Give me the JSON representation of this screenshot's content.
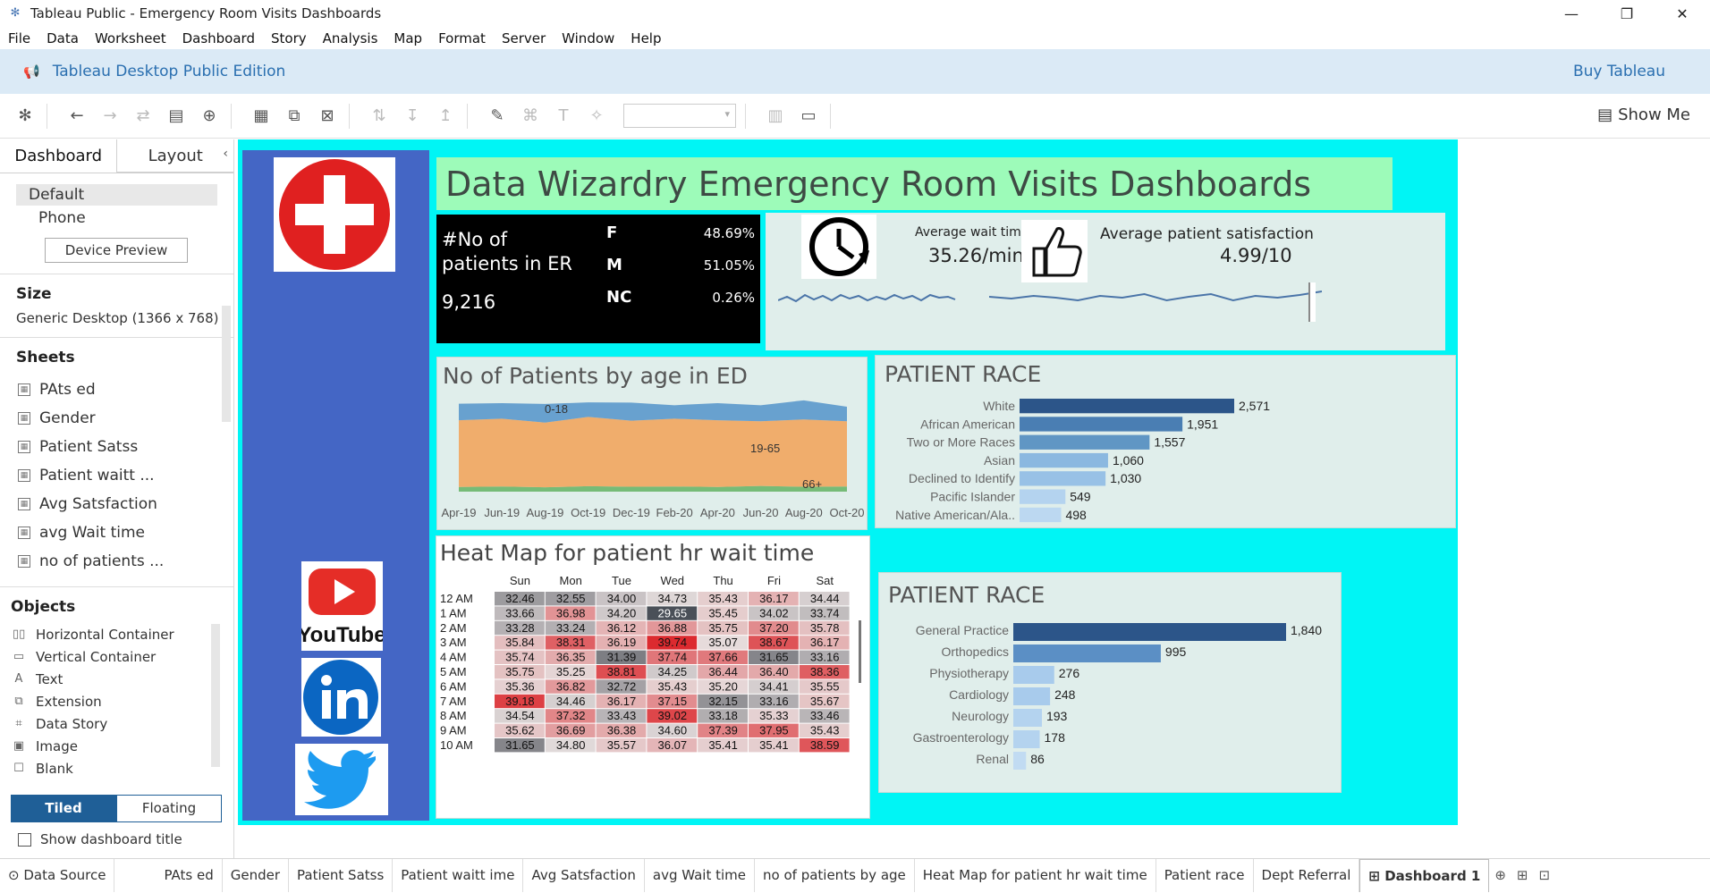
{
  "window": {
    "title": "Tableau Public - Emergency Room Visits Dashboards",
    "minimize": "—",
    "maximize": "❐",
    "close": "✕"
  },
  "menu": [
    "File",
    "Data",
    "Worksheet",
    "Dashboard",
    "Story",
    "Analysis",
    "Map",
    "Format",
    "Server",
    "Window",
    "Help"
  ],
  "banner": {
    "edition": "Tableau Desktop Public Edition",
    "buy": "Buy Tableau"
  },
  "toolbar": {
    "show_me": "Show Me"
  },
  "left_pane": {
    "tab_dashboard": "Dashboard",
    "tab_layout": "Layout",
    "collapse": "‹",
    "device_default": "Default",
    "device_phone": "Phone",
    "device_preview": "Device Preview",
    "size_heading": "Size",
    "size_value": "Generic Desktop (1366 x 768) ▾",
    "sheets_heading": "Sheets",
    "sheets": [
      "PAts ed",
      "Gender",
      "Patient Satss",
      "Patient waitt ...",
      "Avg Satsfaction",
      "avg Wait time",
      "no of patients ..."
    ],
    "objects_heading": "Objects",
    "objects": [
      {
        "icon": "horizontal-container-icon",
        "glyph": "▯▯",
        "label": "Horizontal Container"
      },
      {
        "icon": "vertical-container-icon",
        "glyph": "▭",
        "label": "Vertical Container"
      },
      {
        "icon": "text-icon",
        "glyph": "A",
        "label": "Text"
      },
      {
        "icon": "extension-icon",
        "glyph": "⧉",
        "label": "Extension"
      },
      {
        "icon": "data-story-icon",
        "glyph": "⌗",
        "label": "Data Story"
      },
      {
        "icon": "image-icon",
        "glyph": "▣",
        "label": "Image"
      },
      {
        "icon": "blank-icon",
        "glyph": "☐",
        "label": "Blank"
      }
    ],
    "tiled": "Tiled",
    "floating": "Floating",
    "show_title": "Show dashboard title"
  },
  "dashboard": {
    "title": "Data Wizardry Emergency Room Visits Dashboards",
    "kpi": {
      "patients_label_1": "#No of",
      "patients_label_2": "patients in ER",
      "patients_value": "9,216",
      "genders": [
        {
          "label": "F",
          "value": "48.69%"
        },
        {
          "label": "M",
          "value": "51.05%"
        },
        {
          "label": "NC",
          "value": "0.26%"
        }
      ],
      "wait_label": "Average wait time",
      "wait_value": "35.26/min",
      "sat_label": "Average patient satisfaction",
      "sat_value": "4.99/10"
    },
    "age_chart": {
      "title": "No of Patients by age in ED",
      "x_ticks": [
        "Apr-19",
        "Jun-19",
        "Aug-19",
        "Oct-19",
        "Dec-19",
        "Feb-20",
        "Apr-20",
        "Jun-20",
        "Aug-20",
        "Oct-20"
      ],
      "labels": [
        "0-18",
        "19-65",
        "66+"
      ],
      "colors": {
        "0-18": "#5b98cc",
        "19-65": "#f2a55e",
        "66+": "#6ab56a"
      }
    },
    "race_chart": {
      "title": "PATIENT RACE",
      "max": 2571
    },
    "dept_chart": {
      "title": "PATIENT RACE",
      "max": 1840
    },
    "heatmap": {
      "title": "Heat Map for patient hr wait time",
      "days": [
        "Sun",
        "Mon",
        "Tue",
        "Wed",
        "Thu",
        "Fri",
        "Sat"
      ],
      "rows": [
        {
          "hour": "12 AM",
          "values": [
            "32.46",
            "32.55",
            "34.00",
            "34.73",
            "35.43",
            "36.17",
            "34.44"
          ]
        },
        {
          "hour": "1 AM",
          "values": [
            "33.66",
            "36.98",
            "34.20",
            "29.65",
            "35.45",
            "34.02",
            "33.74"
          ]
        },
        {
          "hour": "2 AM",
          "values": [
            "33.28",
            "33.24",
            "36.12",
            "36.88",
            "35.75",
            "37.20",
            "35.78"
          ]
        },
        {
          "hour": "3 AM",
          "values": [
            "35.84",
            "38.31",
            "36.19",
            "39.74",
            "35.07",
            "38.67",
            "36.17"
          ]
        },
        {
          "hour": "4 AM",
          "values": [
            "35.74",
            "36.35",
            "31.39",
            "37.74",
            "37.66",
            "31.65",
            "33.16"
          ]
        },
        {
          "hour": "5 AM",
          "values": [
            "35.75",
            "35.25",
            "38.81",
            "34.25",
            "36.44",
            "36.40",
            "38.36"
          ]
        },
        {
          "hour": "6 AM",
          "values": [
            "35.36",
            "36.82",
            "32.72",
            "35.43",
            "35.20",
            "34.41",
            "35.55"
          ]
        },
        {
          "hour": "7 AM",
          "values": [
            "39.18",
            "34.46",
            "36.17",
            "37.15",
            "32.15",
            "33.16",
            "35.67"
          ]
        },
        {
          "hour": "8 AM",
          "values": [
            "34.54",
            "37.32",
            "33.43",
            "39.02",
            "33.18",
            "35.33",
            "33.46"
          ]
        },
        {
          "hour": "9 AM",
          "values": [
            "35.62",
            "36.69",
            "36.38",
            "34.60",
            "37.39",
            "37.95",
            "35.43"
          ]
        },
        {
          "hour": "10 AM",
          "values": [
            "31.65",
            "34.80",
            "35.57",
            "36.07",
            "35.41",
            "35.41",
            "38.59"
          ]
        }
      ]
    }
  },
  "chart_data": [
    {
      "type": "area",
      "title": "No of Patients by age in ED",
      "x": [
        "Apr-19",
        "Jun-19",
        "Aug-19",
        "Oct-19",
        "Dec-19",
        "Feb-20",
        "Apr-20",
        "Jun-20",
        "Aug-20",
        "Oct-20"
      ],
      "series": [
        {
          "name": "66+",
          "values": [
            18,
            20,
            17,
            21,
            19,
            20,
            18,
            22,
            19,
            20
          ]
        },
        {
          "name": "19-65",
          "values": [
            258,
            262,
            250,
            268,
            255,
            262,
            258,
            250,
            260,
            252
          ]
        },
        {
          "name": "0-18",
          "values": [
            64,
            60,
            72,
            56,
            70,
            52,
            66,
            62,
            74,
            56
          ]
        }
      ]
    },
    {
      "type": "bar",
      "title": "PATIENT RACE",
      "categories": [
        "White",
        "African American",
        "Two or More Races",
        "Asian",
        "Declined to Identify",
        "Pacific Islander",
        "Native American/Ala.."
      ],
      "values": [
        2571,
        1951,
        1557,
        1060,
        1030,
        549,
        498
      ],
      "labels": [
        "2,571",
        "1,951",
        "1,557",
        "1,060",
        "1,030",
        "549",
        "498"
      ]
    },
    {
      "type": "bar",
      "title": "PATIENT RACE",
      "categories": [
        "General Practice",
        "Orthopedics",
        "Physiotherapy",
        "Cardiology",
        "Neurology",
        "Gastroenterology",
        "Renal"
      ],
      "values": [
        1840,
        995,
        276,
        248,
        193,
        178,
        86
      ],
      "labels": [
        "1,840",
        "995",
        "276",
        "248",
        "193",
        "178",
        "86"
      ]
    },
    {
      "type": "heatmap",
      "title": "Heat Map for patient hr wait time",
      "x": [
        "Sun",
        "Mon",
        "Tue",
        "Wed",
        "Thu",
        "Fri",
        "Sat"
      ],
      "y": [
        "12 AM",
        "1 AM",
        "2 AM",
        "3 AM",
        "4 AM",
        "5 AM",
        "6 AM",
        "7 AM",
        "8 AM",
        "9 AM",
        "10 AM"
      ]
    }
  ],
  "sheet_tabs": [
    "Data Source",
    "PAts ed",
    "Gender",
    "Patient Satss",
    "Patient waitt ime",
    "Avg Satsfaction",
    "avg Wait time",
    "no of patients by age",
    "Heat Map for patient hr wait time",
    "Patient race",
    "Dept Referral",
    "Dashboard 1"
  ],
  "social": [
    "YouTube"
  ]
}
